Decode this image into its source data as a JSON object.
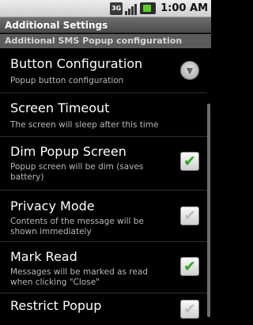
{
  "status_bar": {
    "network_label": "3G",
    "time": "1:00 AM",
    "icons": [
      "network-3g-icon",
      "signal-icon",
      "battery-icon"
    ]
  },
  "title_bar": {
    "title": "Additional Settings"
  },
  "section": {
    "header": "Additional SMS Popup configuration"
  },
  "settings": [
    {
      "title": "Button Configuration",
      "summary": "Popup button configuration",
      "control": "dropdown",
      "checked": null
    },
    {
      "title": "Screen Timeout",
      "summary": "The screen will sleep after this time",
      "control": "none",
      "checked": null
    },
    {
      "title": "Dim Popup Screen",
      "summary": "Popup screen will be dim (saves battery)",
      "control": "checkbox",
      "checked": true
    },
    {
      "title": "Privacy Mode",
      "summary": "Contents of the message will be shown immediately",
      "control": "checkbox",
      "checked": false
    },
    {
      "title": "Mark Read",
      "summary": "Messages will be marked as read when clicking \"Close\"",
      "control": "checkbox",
      "checked": true
    },
    {
      "title": "Restrict Popup",
      "summary": "",
      "control": "checkbox",
      "checked": false
    }
  ],
  "colors": {
    "check_on": "#2fa820",
    "check_off": "#bdbdbd",
    "background": "#000000"
  }
}
